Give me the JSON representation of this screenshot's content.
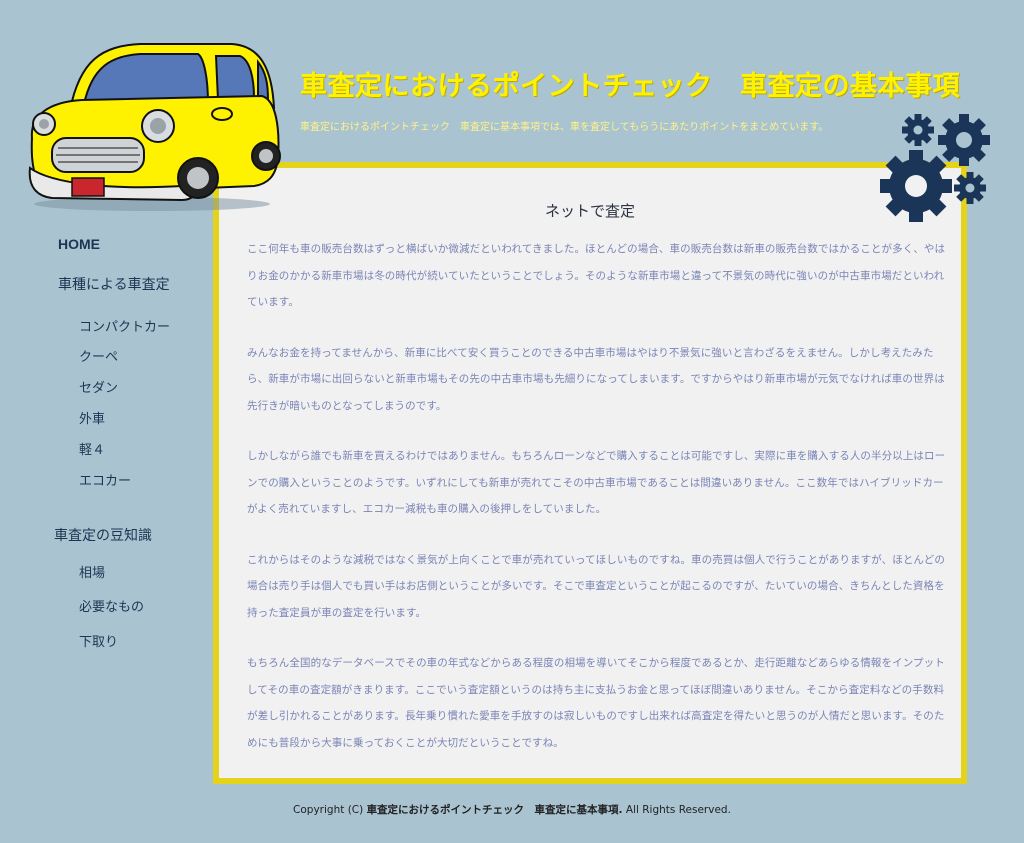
{
  "header": {
    "title": "車査定におけるポイントチェック　車査定の基本事項",
    "description": "車査定におけるポイントチェック　車査定に基本事項では、車を査定してもらうにあたりポイントをまとめています。",
    "car_color": "#fff200",
    "title_color": "#fff200"
  },
  "icons": {
    "car": "yellow-car-icon",
    "gears": "gears-icon"
  },
  "sidebar": {
    "home": "HOME",
    "section1": {
      "label": "車種による車査定",
      "items": [
        "コンパクトカー",
        "クーペ",
        "セダン",
        "外車",
        "軽４",
        "エコカー"
      ]
    },
    "section2": {
      "label": "車査定の豆知識",
      "items": [
        "相場",
        "必要なもの",
        "下取り"
      ]
    }
  },
  "main": {
    "heading": "ネットで査定",
    "paragraphs": [
      "ここ何年も車の販売台数はずっと横ばいか微減だといわれてきました。ほとんどの場合、車の販売台数は新車の販売台数ではかることが多く、やはりお金のかかる新車市場は冬の時代が続いていたということでしょう。そのような新車市場と違って不景気の時代に強いのが中古車市場だといわれています。",
      "みんなお金を持ってませんから、新車に比べて安く買うことのできる中古車市場はやはり不景気に強いと言わざるをえません。しかし考えたみたら、新車が市場に出回らないと新車市場もその先の中古車市場も先細りになってしまいます。ですからやはり新車市場が元気でなければ車の世界は先行きが暗いものとなってしまうのです。",
      "しかしながら誰でも新車を買えるわけではありません。もちろんローンなどで購入することは可能ですし、実際に車を購入する人の半分以上はローンでの購入ということのようです。いずれにしても新車が売れてこその中古車市場であることは間違いありません。ここ数年ではハイブリッドカーがよく売れていますし、エコカー減税も車の購入の後押しをしていました。",
      "これからはそのような減税ではなく景気が上向くことで車が売れていってほしいものですね。車の売買は個人で行うことがありますが、ほとんどの場合は売り手は個人でも買い手はお店側ということが多いです。そこで車査定ということが起こるのですが、たいていの場合、きちんとした資格を持った査定員が車の査定を行います。",
      "もちろん全国的なデータベースでその車の年式などからある程度の相場を導いてそこから程度であるとか、走行距離などあらゆる情報をインプットしてその車の査定額がきまります。ここでいう査定額というのは持ち主に支払うお金と思ってほぼ間違いありません。そこから査定料などの手数料が差し引かれることがあります。長年乗り慣れた愛車を手放すのは寂しいものですし出来れば高査定を得たいと思うのが人情だと思います。そのためにも普段から大事に乗っておくことが大切だということですね。"
    ]
  },
  "footer": {
    "prefix": "Copyright (C) ",
    "site_name": "車査定におけるポイントチェック　車査定に基本事項.",
    "suffix": " All Rights Reserved."
  },
  "colors": {
    "background": "#a9c3d1",
    "frame": "#e4d319",
    "body_text": "#7a84b6",
    "nav_text": "#1f3452",
    "gear": "#1b3558"
  }
}
